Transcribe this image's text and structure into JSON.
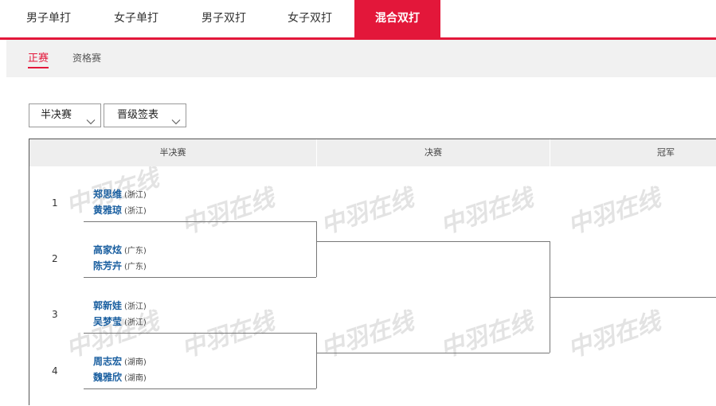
{
  "tabs": [
    {
      "label": "男子单打",
      "active": false
    },
    {
      "label": "女子单打",
      "active": false
    },
    {
      "label": "男子双打",
      "active": false
    },
    {
      "label": "女子双打",
      "active": false
    },
    {
      "label": "混合双打",
      "active": true
    }
  ],
  "subtabs": [
    {
      "label": "正赛",
      "active": true
    },
    {
      "label": "资格赛",
      "active": false
    }
  ],
  "selects": {
    "round": {
      "value": "半决赛"
    },
    "view": {
      "value": "晋级签表"
    }
  },
  "bracket": {
    "headers": [
      "半决赛",
      "决赛",
      "冠军"
    ],
    "matches": [
      {
        "seed": "1",
        "players": [
          {
            "name": "郑思维",
            "province": "(浙江)"
          },
          {
            "name": "黄雅琼",
            "province": "(浙江)"
          }
        ]
      },
      {
        "seed": "2",
        "players": [
          {
            "name": "高家炫",
            "province": "(广东)"
          },
          {
            "name": "陈芳卉",
            "province": "(广东)"
          }
        ]
      },
      {
        "seed": "3",
        "players": [
          {
            "name": "郭新娃",
            "province": "(浙江)"
          },
          {
            "name": "吴梦莹",
            "province": "(浙江)"
          }
        ]
      },
      {
        "seed": "4",
        "players": [
          {
            "name": "周志宏",
            "province": "(湖南)"
          },
          {
            "name": "魏雅欣",
            "province": "(湖南)"
          }
        ]
      }
    ]
  },
  "watermark": {
    "text": "中羽在线",
    "color": "#e0e0e0"
  },
  "colors": {
    "accent": "#e3173a",
    "link": "#1a5fa0",
    "header_bg": "#eeeeee"
  }
}
